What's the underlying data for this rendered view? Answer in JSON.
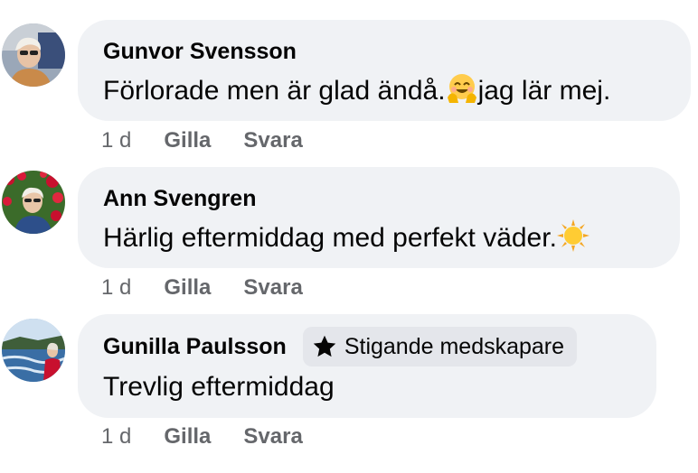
{
  "comments": [
    {
      "author": "Gunvor Svensson",
      "text_before": "Förlorade men är glad ändå.",
      "emoji": "smiling-face-with-open-hands-emoji",
      "text_after": "jag lär mej.",
      "time": "1 d",
      "like_label": "Gilla",
      "reply_label": "Svara"
    },
    {
      "author": "Ann Svengren",
      "text_before": "Härlig eftermiddag med perfekt väder.",
      "emoji": "sun-emoji",
      "text_after": "",
      "time": "1 d",
      "like_label": "Gilla",
      "reply_label": "Svara"
    },
    {
      "author": "Gunilla Paulsson",
      "badge": "Stigande medskapare",
      "badge_icon": "star-icon",
      "text_before": "Trevlig eftermiddag",
      "text_after": "",
      "time": "1 d",
      "like_label": "Gilla",
      "reply_label": "Svara"
    }
  ],
  "colors": {
    "bubble": "#f0f2f5",
    "badge": "#e4e6eb",
    "text": "#050505",
    "secondary_text": "#65676b"
  }
}
